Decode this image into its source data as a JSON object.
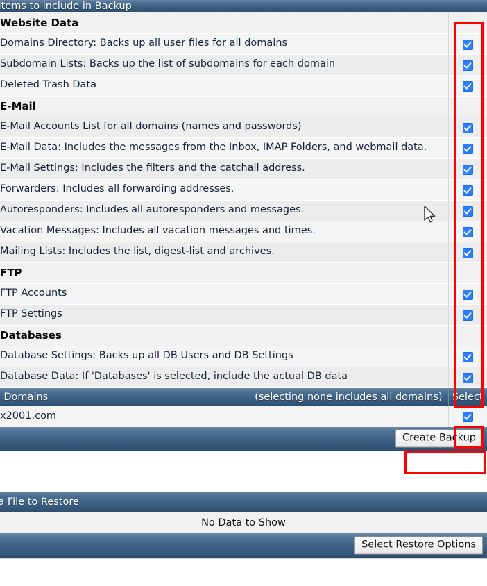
{
  "page": {
    "title_bar": "Select Items to include in Backup",
    "restore_bar": "Select a File to Restore",
    "no_data_text": "No Data to Show"
  },
  "sections": [
    {
      "name": "website-data",
      "heading": "Website Data",
      "items": [
        {
          "label": "Domains Directory: Backs up all user files for all domains",
          "checked": true
        },
        {
          "label": "Subdomain Lists: Backs up the list of subdomains for each domain",
          "checked": true
        },
        {
          "label": "Deleted Trash Data",
          "checked": true
        }
      ]
    },
    {
      "name": "e-mail",
      "heading": "E-Mail",
      "items": [
        {
          "label": "E-Mail Accounts List for all domains (names and passwords)",
          "checked": true
        },
        {
          "label": "E-Mail Data: Includes the messages from the Inbox, IMAP Folders, and webmail data.",
          "checked": true
        },
        {
          "label": "E-Mail Settings: Includes the filters and the catchall address.",
          "checked": true
        },
        {
          "label": "Forwarders: Includes all forwarding addresses.",
          "checked": true
        },
        {
          "label": "Autoresponders: Includes all autoresponders and messages.",
          "checked": true
        },
        {
          "label": "Vacation Messages: Includes all vacation messages and times.",
          "checked": true
        },
        {
          "label": "Mailing Lists: Includes the list, digest-list and archives.",
          "checked": true
        }
      ]
    },
    {
      "name": "ftp",
      "heading": "FTP",
      "items": [
        {
          "label": "FTP Accounts",
          "checked": true
        },
        {
          "label": "FTP Settings",
          "checked": true
        }
      ]
    },
    {
      "name": "databases",
      "heading": "Databases",
      "items": [
        {
          "label": "Database Settings: Backs up all DB Users and DB Settings",
          "checked": true
        },
        {
          "label": "Database Data: If 'Databases' is selected, include the actual DB data",
          "checked": true
        }
      ]
    }
  ],
  "domains": {
    "bar_label": "Include Domains",
    "bar_note": "(selecting none includes all domains)",
    "select_column_header": "Select",
    "rows": [
      {
        "domain": "x2001.com",
        "checked": true
      }
    ]
  },
  "buttons": {
    "create_backup": "Create Backup",
    "select_restore_options": "Select Restore Options"
  },
  "colors": {
    "bar_top": "#6a87a4",
    "bar_bottom": "#2f4e6d",
    "checkbox_blue": "#2b7fff",
    "highlight_red": "#fe0000",
    "row_light": "#f4f4f4",
    "row_dark": "#ececec"
  }
}
